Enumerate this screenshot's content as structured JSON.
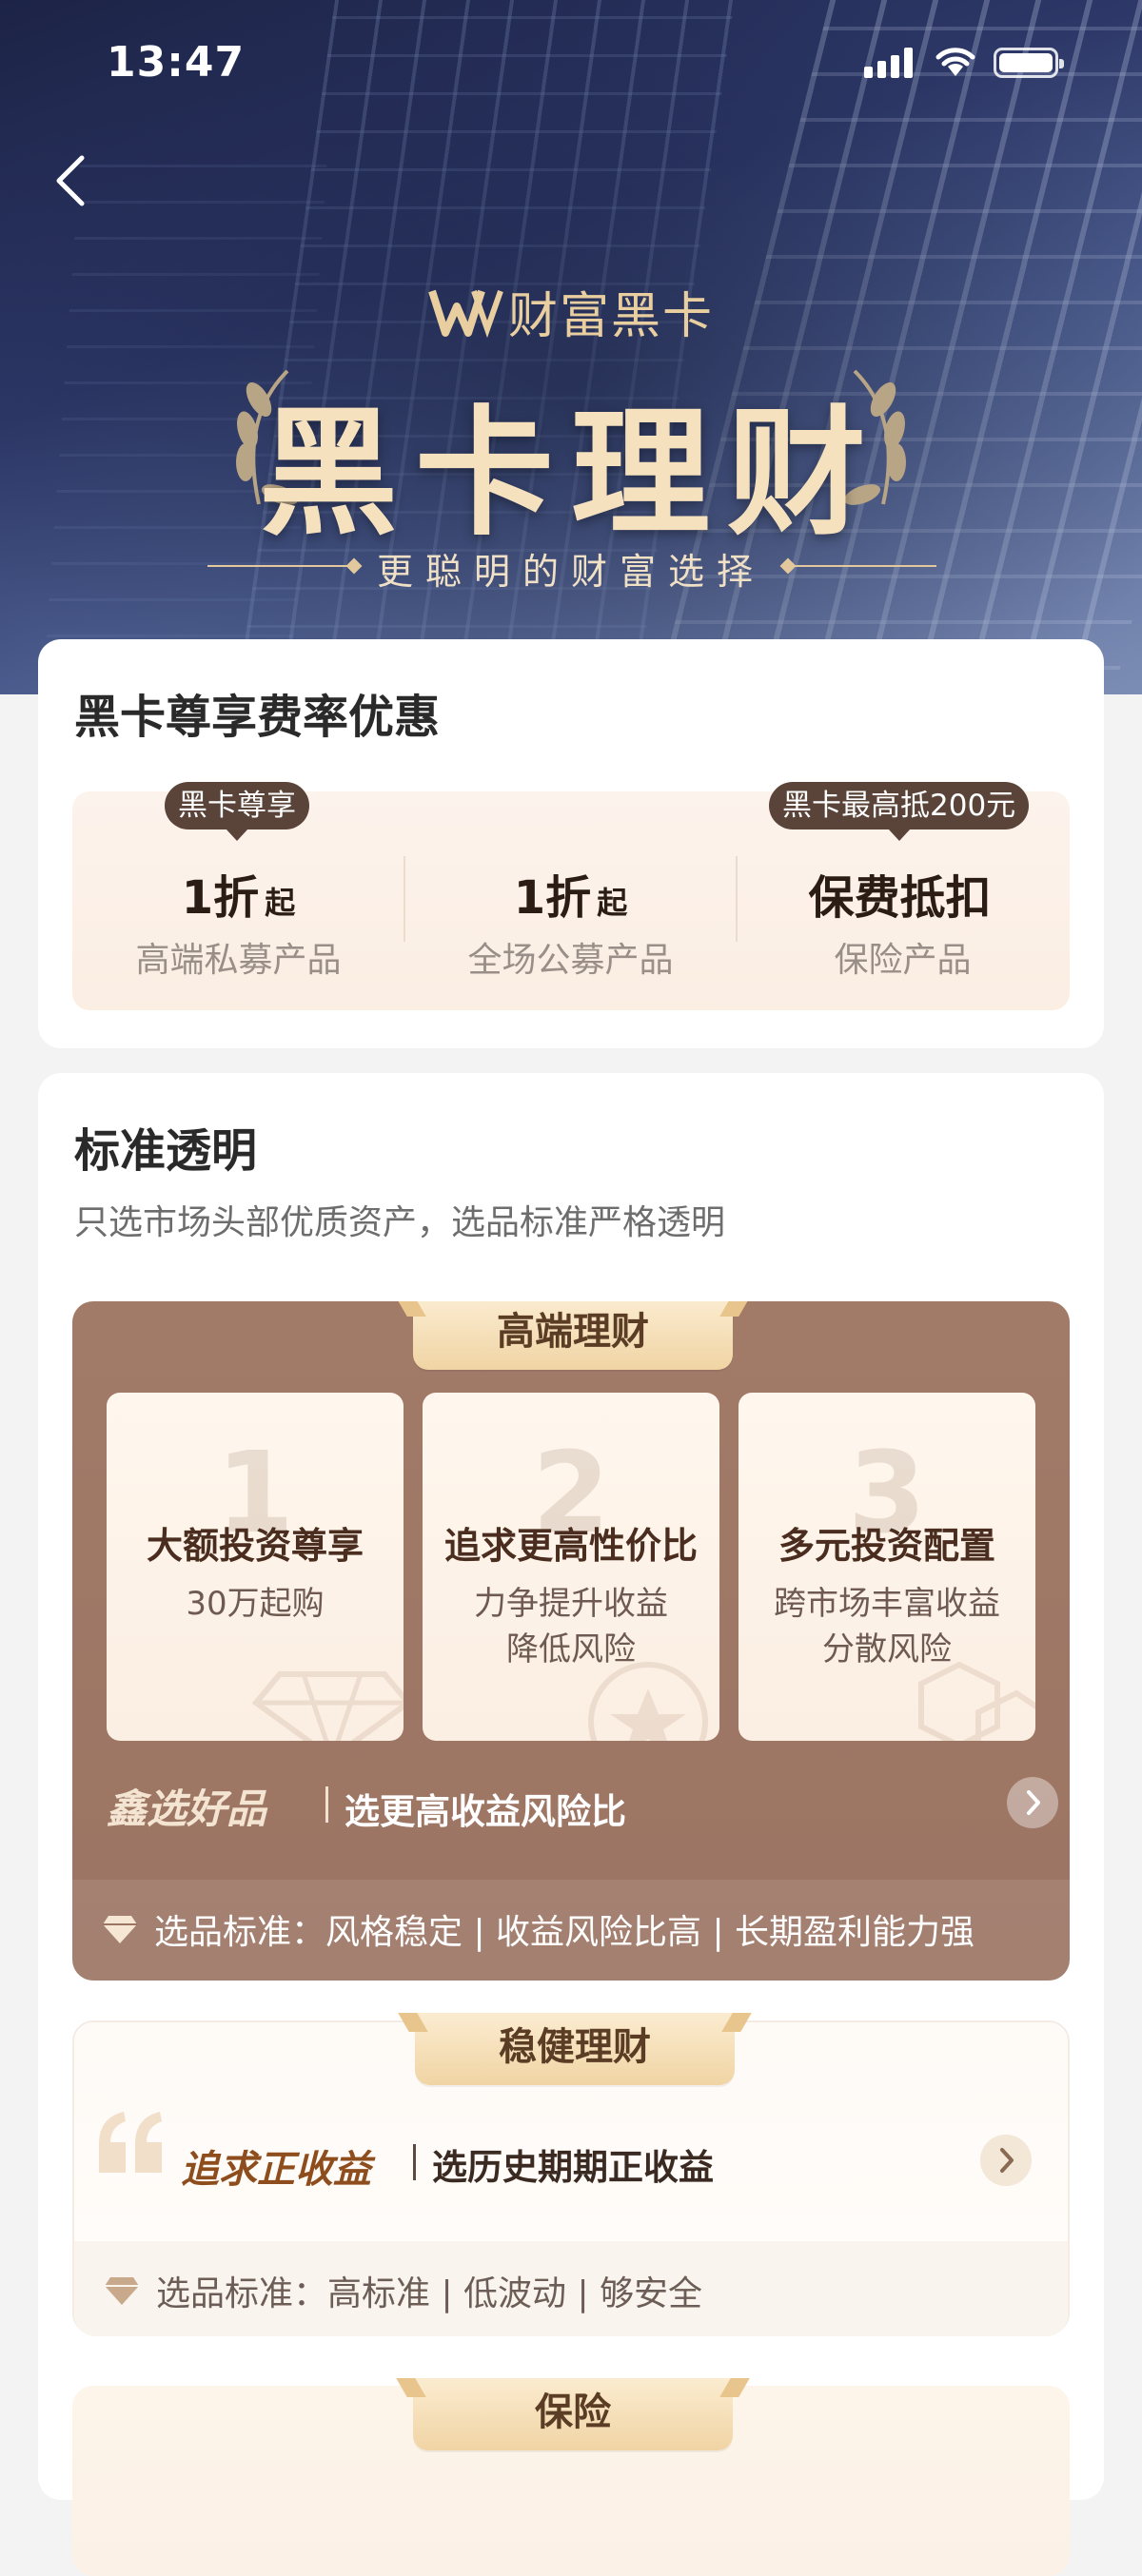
{
  "status_bar": {
    "time": "13:47"
  },
  "hero": {
    "brand": "财富黑卡",
    "title": "黑卡理财",
    "tagline": "更聪明的财富选择"
  },
  "discount": {
    "title": "黑卡尊享费率优惠",
    "badge_left": "黑卡尊享",
    "badge_right": "黑卡最高抵200元",
    "items": [
      {
        "value": "1折",
        "suffix": "起",
        "label": "高端私募产品"
      },
      {
        "value": "1折",
        "suffix": "起",
        "label": "全场公募产品"
      },
      {
        "value": "保费抵扣",
        "suffix": "",
        "label": "保险产品"
      }
    ]
  },
  "standards": {
    "title": "标准透明",
    "subtitle": "只选市场头部优质资产，选品标准严格透明",
    "premium": {
      "tab": "高端理财",
      "features": [
        {
          "num": "1",
          "title": "大额投资尊享",
          "desc": "30万起购"
        },
        {
          "num": "2",
          "title": "追求更高性价比",
          "desc": "力争提升收益\n降低风险"
        },
        {
          "num": "3",
          "title": "多元投资配置",
          "desc": "跨市场丰富收益\n分散风险"
        }
      ],
      "brand": "鑫选好品",
      "brand_text": "选更高收益风险比",
      "criteria": "选品标准：风格稳定 | 收益风险比高 | 长期盈利能力强"
    },
    "stable": {
      "tab": "稳健理财",
      "brand": "追求正收益",
      "brand_text": "选历史期期正收益",
      "criteria": "选品标准：高标准 | 低波动 | 够安全"
    },
    "insurance": {
      "tab": "保险"
    }
  }
}
